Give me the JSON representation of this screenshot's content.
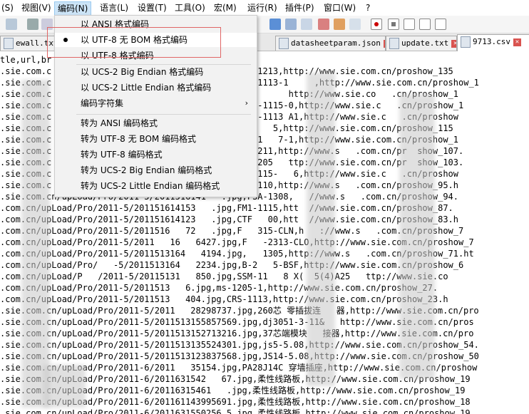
{
  "menubar": {
    "items": [
      {
        "label": "(S)"
      },
      {
        "label": "视图(V)"
      },
      {
        "label": "编码(N)"
      },
      {
        "label": "语言(L)"
      },
      {
        "label": "设置(T)"
      },
      {
        "label": "工具(O)"
      },
      {
        "label": "宏(M)"
      },
      {
        "label": "运行(R)"
      },
      {
        "label": "插件(P)"
      },
      {
        "label": "窗口(W)"
      },
      {
        "label": "?"
      }
    ]
  },
  "tabs": [
    {
      "label": "ewall.txt"
    },
    {
      "label": "datasheetparam.json"
    },
    {
      "label": "update.txt"
    },
    {
      "label": "9713.csv"
    }
  ],
  "encoding_menu": {
    "items": [
      {
        "label": "以 ANSI 格式编码"
      },
      {
        "label": "以 UTF-8 无 BOM 格式编码",
        "selected": true
      },
      {
        "label": "以 UTF-8 格式编码"
      },
      {
        "label": "以 UCS-2 Big Endian 格式编码"
      },
      {
        "label": "以 UCS-2 Little Endian 格式编码"
      },
      {
        "label": "编码字符集",
        "submenu": true
      },
      {
        "label": "转为 ANSI 编码格式"
      },
      {
        "label": "转为 UTF-8 无 BOM 编码格式"
      },
      {
        "label": "转为 UTF-8 编码格式"
      },
      {
        "label": "转为 UCS-2 Big Endian 编码格式"
      },
      {
        "label": "转为 UCS-2 Little Endian 编码格式"
      }
    ]
  },
  "editor": {
    "lines": [
      "tle,url,br",
      ".sie.com.c                              1.jpg,ssm-1213,http://www.sie.com.cn/proshow_135",
      ".sie.com.c                              8.jpg,ssm-1113-1     ,http://www.sie.com.cn/proshow_1",
      ".sie.com.c                              6.jpg,SSD-      http://www.sie.co   .cn/proshow_1",
      ".sie.com.c                              1.jpg,s   -1115-0,http://www.sie.c   .cn/proshow_1",
      ".sie.com.c                              9.jpg,   L-1113 A1,http://www.sie.c   .cn/proshow",
      ".sie.com.c                              7.jpg,sl-1   5,http://www.sie.com.cn/proshow_115",
      ".sie.com.c                              7.jpg,PS1-1   7-1,http://www.sie.com.cn/proshow_1",
      ".sie.com.c                              4.jpg,ms-1211,http://www.s   .com.cn/pr  show_107.",
      ".sie.com.c                              1.jpg,ms-1205   ttp://www.sie.com.cn/pr  show_103.",
      ".sie.com.c                              8.jpg,MS-1115-   6,http://www.sie.c   .cn/proshow",
      ".sie.com.c                              9.jpg,ms-1110,http://www.s   .com.cn/proshow_95.h",
      ".sie.com.cn/upLoad/Pro/2011-5/2011516141   .jpg,FSA-1308,   //www.s   .com.cn/proshow_94.",
      ".com.cn/upLoad/Pro/2011-5/201151614153   .jpg,FM1-1115,htt  //www.sie.com.cn/proshow_87.",
      ".com.cn/upLoad/Pro/2011-5/201151614123   .jpg,CTF   00,htt  //www.sie.com.cn/proshow_83.h",
      ".com.cn/upLoad/Pro/2011-5/2011516   72   .jpg,F   315-CLN,h   ://www.s   .com.cn/proshow_7",
      ".com.cn/upLoad/Pro/2011-5/2011   16   6427.jpg,F   -2313-CLO,http://www.sie.com.cn/proshow_7",
      ".com.cn/upLoad/Pro/2011-5/2011513164   4194.jpg,   1305,http://www.s   .com.cn/proshow_71.ht",
      ".com.cn/upLoad/Pro/   -5/2011513164   2234.jpg,B-2   5-BSF,http://www.sie.com.cn/proshow_6",
      ".com.cn/upLoad/P   /2011-5/20115131   850.jpg,SSM-11   8 X(  5(4)A25   ttp://www.sie.co",
      ".com.cn/upLoad/Pro/2011-5/2011513   6.jpg,ms-1205-1,http://www.sie.com.cn/proshow_27.",
      ".com.cn/upLoad/Pro/2011-5/2011513   404.jpg,CRS-1113,http://www.sie.com.cn/proshow_23.h",
      ".sie.com.cn/upLoad/Pro/2011-5/2011   28298737.jpg,260芯 零插拔连   器,http://www.sie.com.cn/pro",
      ".sie.com.cn/upLoad/Pro/2011-5/2011513155857569.jpg,dj3051-3-11&   http://www.sie.com.cn/pros",
      ".sie.com.cn/upLoad/Pro/2011-5/2011513152713216.jpg,37芯端模块   接器,http://www.sie.com.cn/pro",
      ".sie.com.cn/upLoad/Pro/2011-5/2011513135524301.jpg,js5-5.08,http://www.sie.com.cn/proshow_54.",
      ".sie.com.cn/upLoad/Pro/2011-5/2011513123837568.jpg,JS14-5.08,http://www.sie.com.cn/proshow_50",
      ".sie.com.cn/upLoad/Pro/2011-6/2011   35154.jpg,PA28J14C 穿墙插座,http://www.sie.com.cn/proshow",
      ".sie.com.cn/upLoad/Pro/2011-6/2011631542   67.jpg,柔性线路板,http://www.sie.com.cn/proshow_19",
      ".sie.com.cn/upLoad/Pro/2011-6/20116315461   .jpg,柔性线路板,http://www.sie.com.cn/proshow_19",
      ".sie.com.cn/upLoad/Pro/2011-6/201161143995691.jpg,柔性线路板,http://www.sie.com.cn/proshow_18",
      ".sie.com.cn/upLoad/Pro/2011-6/2011631550256 5.jpg,柔性线路板,http://www.sie.com.cn/proshow_19"
    ]
  }
}
